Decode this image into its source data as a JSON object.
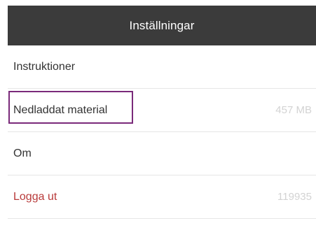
{
  "header": {
    "title": "Inställningar"
  },
  "list": {
    "items": [
      {
        "label": "Instruktioner",
        "value": ""
      },
      {
        "label": "Nedladdat material",
        "value": "457 MB"
      },
      {
        "label": "Om",
        "value": ""
      },
      {
        "label": "Logga ut",
        "value": "119935"
      }
    ]
  },
  "colors": {
    "header_bg": "#3b3b3b",
    "header_text": "#ffffff",
    "logout_text": "#b83a3a",
    "highlight_border": "#7a2a7a",
    "value_text": "#d3d3d3",
    "divider": "#e6e6e6"
  }
}
